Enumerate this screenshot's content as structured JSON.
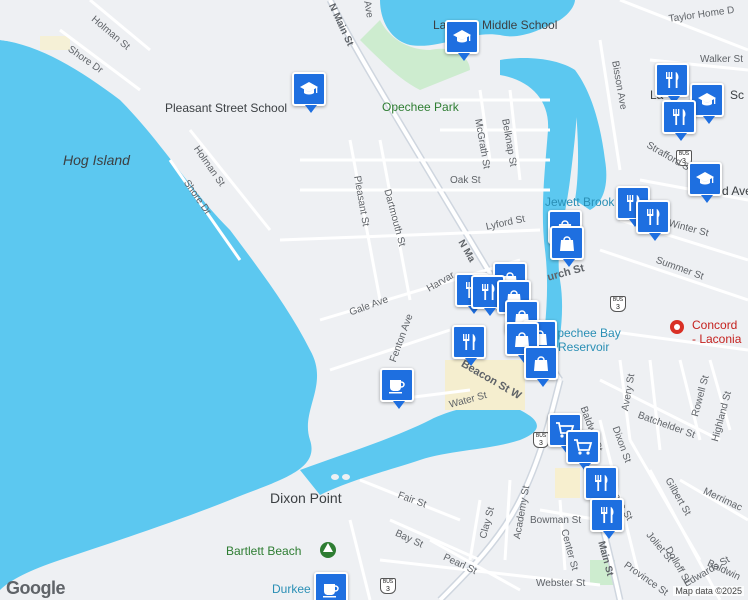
{
  "map": {
    "places": {
      "hog_island": "Hog Island",
      "dixon_point": "Dixon Point",
      "pleasant_street_school": "Pleasant Street School",
      "middle_school": "Middle School",
      "middle_school_prefix": "La",
      "opechee_park": "Opechee Park",
      "jewett_brook": "Jewett Brook",
      "opechee_bay_reservoir_1": "Opechee Bay",
      "opechee_bay_reservoir_2": "Reservoir",
      "concord_laconia_1": "Concord",
      "concord_laconia_2": "- Laconia",
      "bartlett_beach": "Bartlett Beach",
      "durkee": "Durkee",
      "la_top_right": "La",
      "sc_top_right": "Sc"
    },
    "streets": {
      "holman_st_top": "Holman St",
      "shore_dr_top": "Shore Dr",
      "holman_st_mid": "Holman St",
      "shore_dr_mid": "Shore Dr",
      "pleasant_st": "Pleasant St",
      "dartmouth_st": "Dartmouth St",
      "n_main_st_top": "N Main St",
      "n_main_st_mid": "N Ma",
      "ave_top": "Ave",
      "mcgrath_st": "McGrath St",
      "belknap_st": "Belknap St",
      "oak_st": "Oak St",
      "lyford_st": "Lyford St",
      "gale_ave": "Gale Ave",
      "harvard": "Harvar",
      "fenton_ave": "Fenton Ave",
      "church_st": "urch St",
      "beacon_st_w": "Beacon St W",
      "water_st": "Water St",
      "fair_st": "Fair St",
      "bay_st": "Bay St",
      "pearl_st": "Pearl St",
      "clay_st": "Clay St",
      "academy_st": "Academy St",
      "bowman_st": "Bowman St",
      "center_st": "Center St",
      "main_st": "Main St",
      "webster_st": "Webster St",
      "bisson_ave": "Bisson Ave",
      "strafford_st": "Strafford St",
      "winter_st": "Winter St",
      "summer_st": "Summer St",
      "avery_st": "Avery St",
      "rowell_st": "Rowell St",
      "highland_st": "Highland St",
      "batchelder_st": "Batchelder St",
      "dixon_st": "Dixon St",
      "baldwin_st_mid": "Baldwin St",
      "gilbert_st": "Gilbert St",
      "merrimac": "Merrimac",
      "joliet_st": "Joliet St",
      "dolloff_st": "Dolloff St",
      "baldwin": "Baldwin",
      "edwards_st": "Edwards St",
      "province_st": "Province St",
      "cottage_st": "age St",
      "taylor_home_dr": "Taylor Home D",
      "walker_st": "Walker St",
      "d_ave": "d Ave"
    },
    "route_shields": {
      "bus": "BUS",
      "three": "3"
    },
    "markers": [
      {
        "type": "school",
        "icon": "school-icon"
      },
      {
        "type": "school",
        "icon": "school-icon"
      },
      {
        "type": "school",
        "icon": "school-icon"
      },
      {
        "type": "school",
        "icon": "school-icon"
      },
      {
        "type": "restaurant",
        "icon": "fork-knife-icon"
      },
      {
        "type": "restaurant",
        "icon": "fork-knife-icon"
      },
      {
        "type": "restaurant",
        "icon": "fork-knife-icon"
      },
      {
        "type": "restaurant",
        "icon": "fork-knife-icon"
      },
      {
        "type": "shopping",
        "icon": "shopping-bag-icon"
      },
      {
        "type": "shopping",
        "icon": "shopping-bag-icon"
      },
      {
        "type": "restaurant",
        "icon": "fork-knife-icon"
      },
      {
        "type": "shopping",
        "icon": "shopping-bag-icon"
      },
      {
        "type": "restaurant",
        "icon": "fork-knife-icon"
      },
      {
        "type": "shopping",
        "icon": "shopping-bag-icon"
      },
      {
        "type": "shopping",
        "icon": "shopping-bag-icon"
      },
      {
        "type": "shopping",
        "icon": "shopping-bag-icon"
      },
      {
        "type": "cafe",
        "icon": "coffee-cup-icon"
      },
      {
        "type": "grocery",
        "icon": "shopping-cart-icon"
      },
      {
        "type": "grocery",
        "icon": "shopping-cart-icon"
      },
      {
        "type": "restaurant",
        "icon": "fork-knife-icon"
      },
      {
        "type": "restaurant",
        "icon": "fork-knife-icon"
      },
      {
        "type": "cafe",
        "icon": "coffee-cup-icon"
      }
    ],
    "logo": "Google",
    "attribution": "Map data ©2025",
    "colors": {
      "water": "#5cc8f0",
      "land": "#eef0f3",
      "park": "#cdeccf",
      "marker": "#1e6fe0",
      "road": "#ffffff",
      "major_road": "#cfd6df"
    }
  }
}
